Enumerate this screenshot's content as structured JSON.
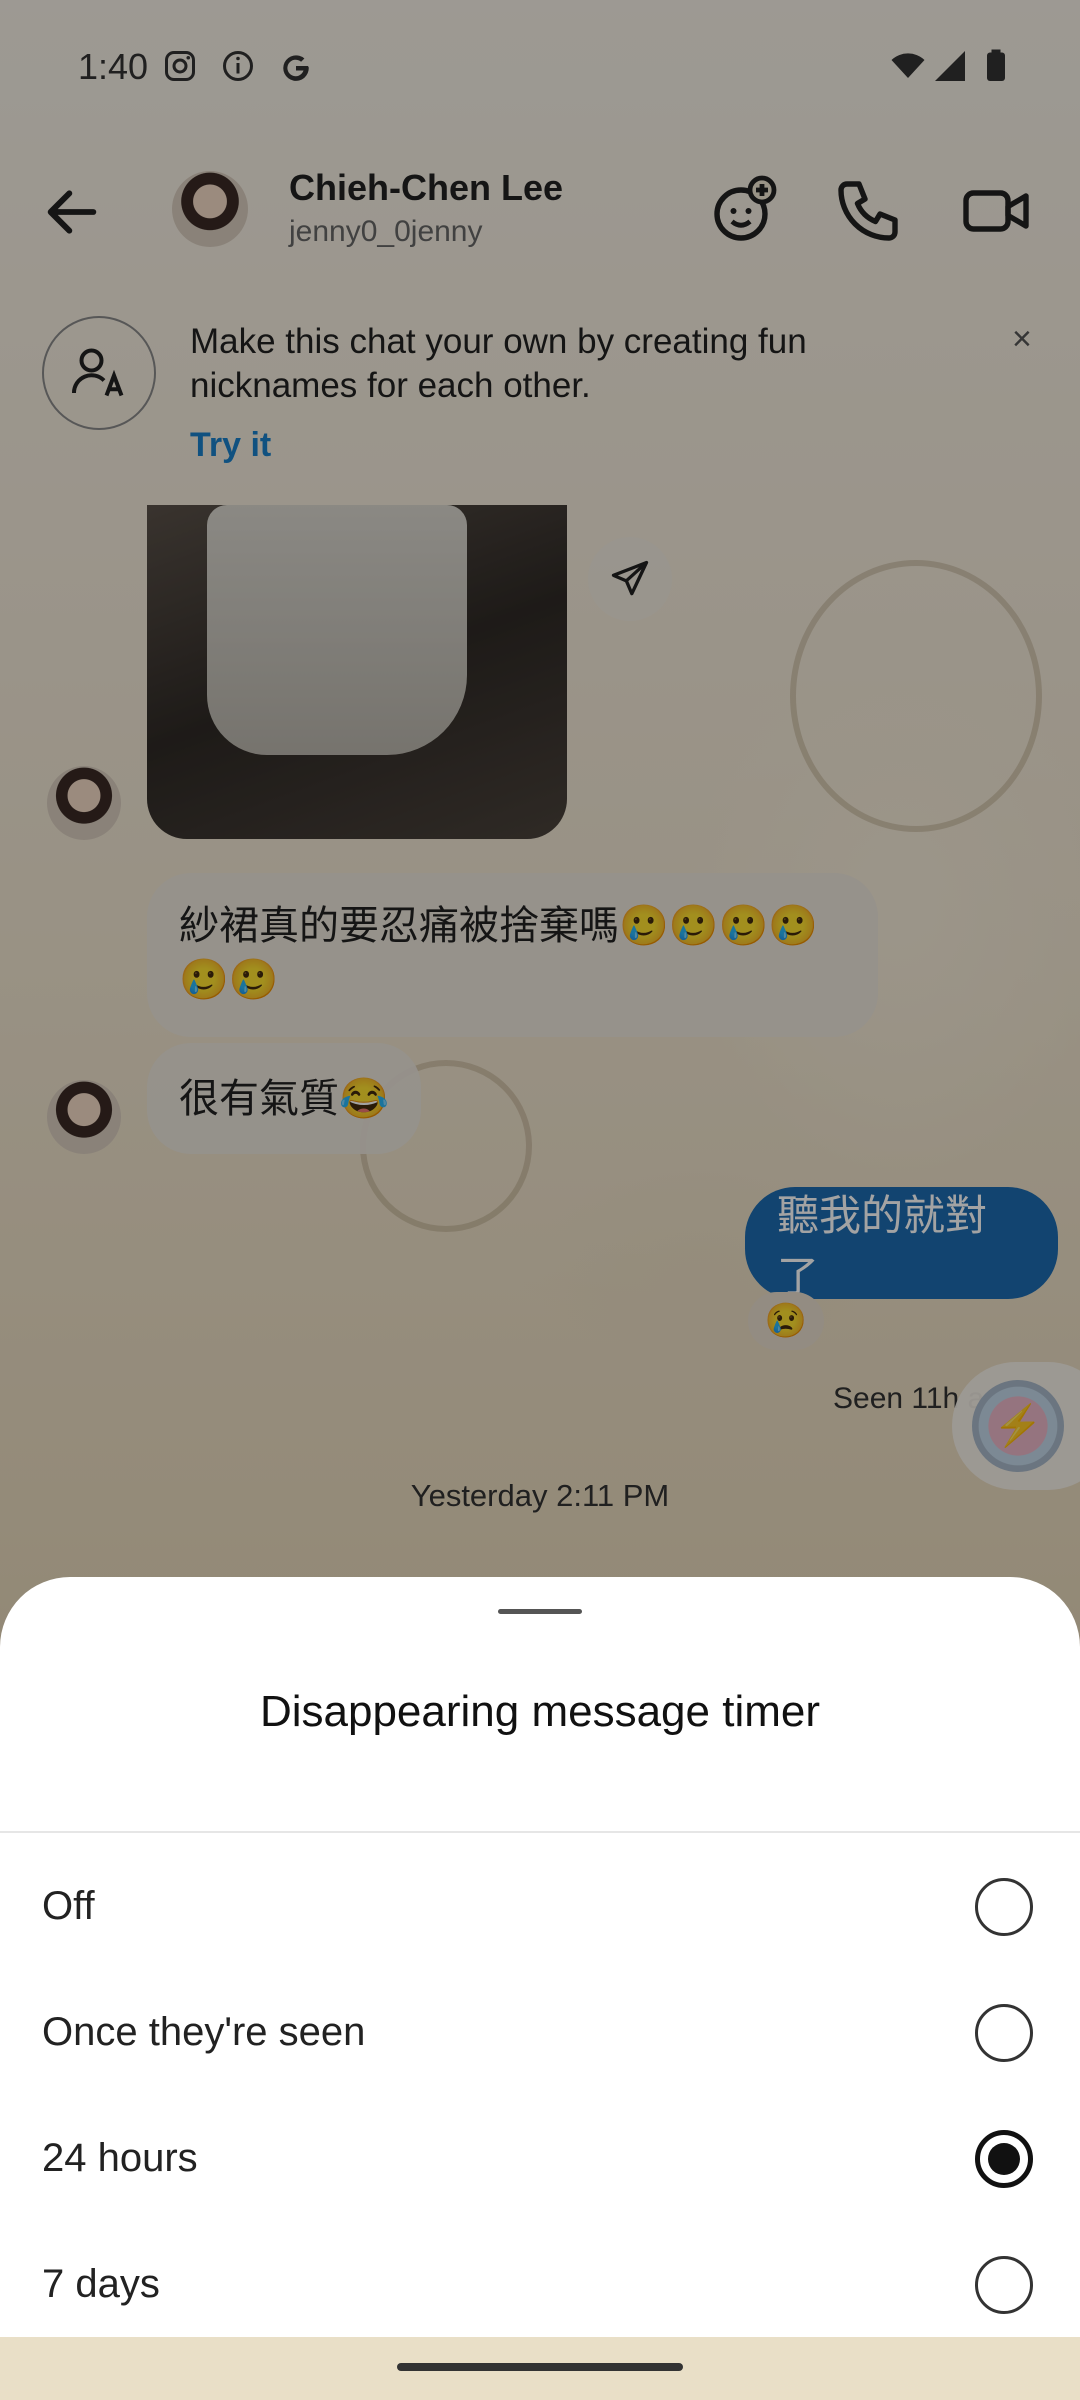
{
  "status_bar": {
    "time": "1:40"
  },
  "header": {
    "contact_name": "Chieh-Chen Lee",
    "contact_handle": "jenny0_0jenny"
  },
  "banner": {
    "text": "Make this chat your own by creating fun nicknames for each other.",
    "link": "Try it",
    "close": "×"
  },
  "messages": {
    "incoming": [
      {
        "text": "紗裙真的要忍痛被捨棄嗎🥲🥲🥲🥲🥲🥲"
      },
      {
        "text": "很有氣質😂"
      }
    ],
    "outgoing": [
      {
        "text": "聽我的就對了",
        "reaction": "😢"
      }
    ],
    "seen": "Seen 11h ago",
    "timestamp": "Yesterday 2:11 PM"
  },
  "sheet": {
    "title": "Disappearing message timer",
    "options": [
      {
        "label": "Off",
        "selected": false
      },
      {
        "label": "Once they're seen",
        "selected": false
      },
      {
        "label": "24 hours",
        "selected": true
      },
      {
        "label": "7 days",
        "selected": false
      }
    ]
  },
  "colors": {
    "accent": "#1a7fc9",
    "outgoing_bubble": "#1d6bb0",
    "sheet_bg": "#ffffff"
  },
  "icons": [
    "instagram-icon",
    "info-icon",
    "google-icon",
    "wifi-icon",
    "signal-icon",
    "battery-icon",
    "back-arrow-icon",
    "add-effect-icon",
    "phone-icon",
    "video-icon",
    "nickname-icon",
    "close-icon",
    "send-icon",
    "ai-brain-icon"
  ]
}
